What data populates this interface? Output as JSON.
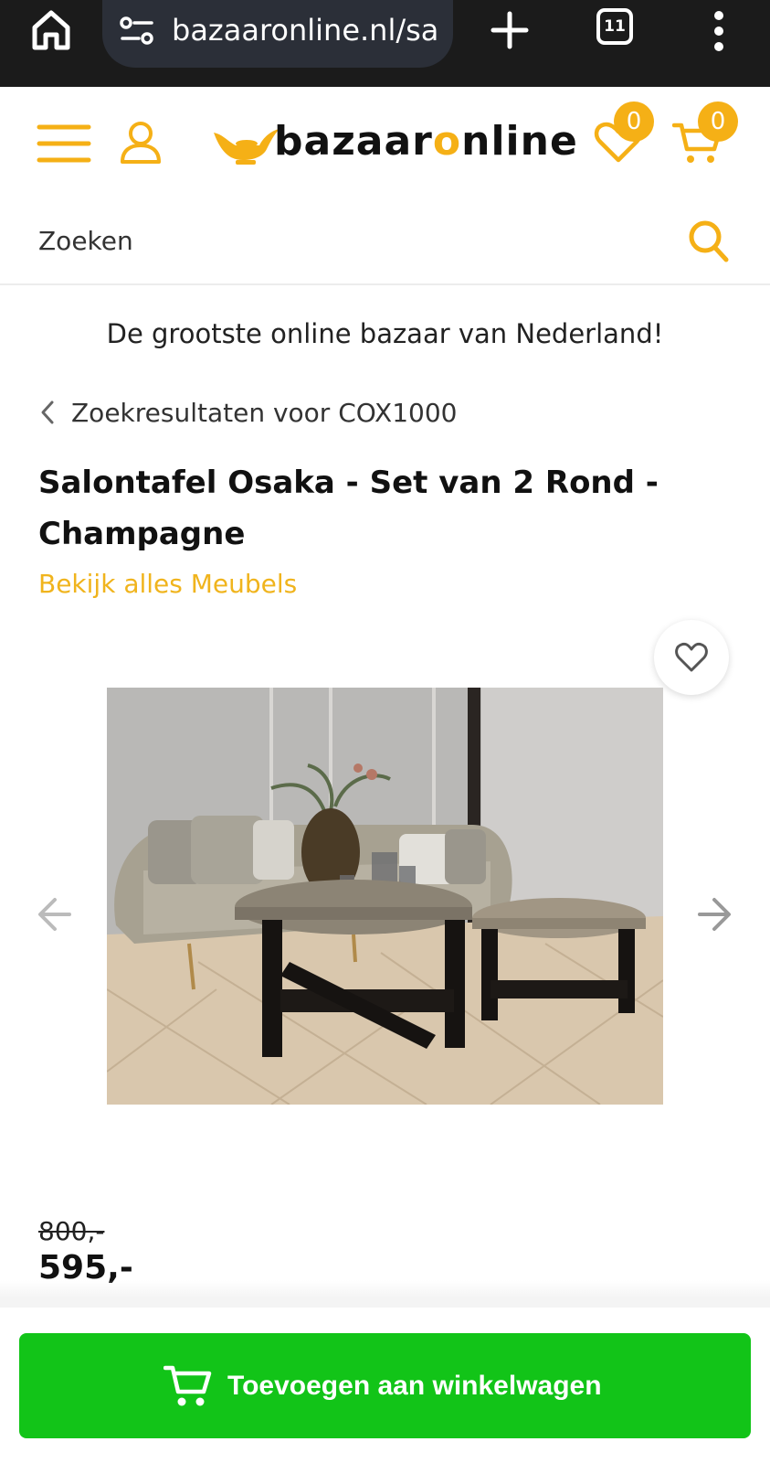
{
  "browser": {
    "url": "bazaaronline.nl/sa",
    "tab_count": "11"
  },
  "header": {
    "logo_text_before": "bazaar",
    "logo_text_accent": "o",
    "logo_text_after": "nline",
    "wishlist_count": "0",
    "cart_count": "0",
    "brand_color": "#f5b016"
  },
  "search": {
    "placeholder": "Zoeken"
  },
  "tagline": "De grootste online bazaar van Nederland!",
  "breadcrumb": "Zoekresultaten voor COX1000",
  "product": {
    "title": "Salontafel Osaka - Set van 2 Rond - Champagne",
    "category_link": "Bekijk alles Meubels",
    "old_price": "800,-",
    "price": "595,-"
  },
  "cta": {
    "label": "Toevoegen aan winkelwagen",
    "color": "#12c418"
  }
}
